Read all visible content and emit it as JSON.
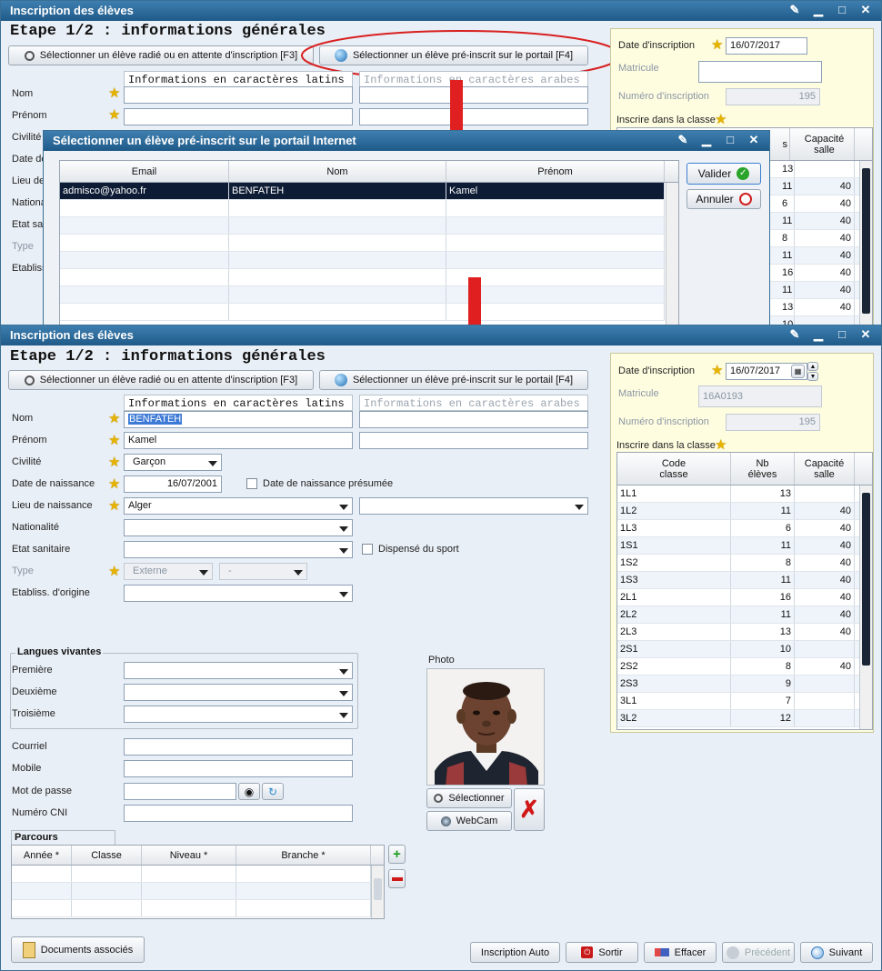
{
  "window_title": "Inscription des élèves",
  "step_title": "Etape 1/2 : informations générales",
  "buttons": {
    "select_radie": "Sélectionner un élève radié ou en attente d'inscription [F3]",
    "select_preinscrit": "Sélectionner un élève pré-inscrit sur le portail [F4]"
  },
  "headers": {
    "latin": "Informations en caractères latins",
    "arabic": "Informations en caractères arabes"
  },
  "labels": {
    "nom": "Nom",
    "prenom": "Prénom",
    "civilite": "Civilité",
    "date_naissance": "Date de naissance",
    "lieu_naissance": "Lieu de naissance",
    "nationalite": "Nationalité",
    "etat_sanitaire": "Etat sanitaire",
    "type": "Type",
    "etabliss": "Etabliss. d'origine",
    "date_presumee": "Date de naissance présumée",
    "dispense": "Dispensé du sport",
    "langues": "Langues vivantes",
    "premiere": "Première",
    "deuxieme": "Deuxième",
    "troisieme": "Troisième",
    "courriel": "Courriel",
    "mobile": "Mobile",
    "mot_de_passe": "Mot de passe",
    "cni": "Numéro CNI",
    "parcours": "Parcours",
    "photo": "Photo",
    "date_inscription": "Date d'inscription",
    "matricule": "Matricule",
    "numero_inscription": "Numéro d'inscription",
    "inscrire_classe": "Inscrire dans la classe"
  },
  "top_window": {
    "date_inscription": "16/07/2017",
    "numero": "195",
    "truncated_labels": [
      "Civilité",
      "Date de",
      "Lieu de",
      "Nationa",
      "Etat sa",
      "Type",
      "Etabliss"
    ],
    "class_col_partial": "s",
    "class_col_capacite": "Capacité\nsalle",
    "rows": [
      {
        "nb": "13",
        "cap": ""
      },
      {
        "nb": "11",
        "cap": "40"
      },
      {
        "nb": "6",
        "cap": "40"
      },
      {
        "nb": "11",
        "cap": "40"
      },
      {
        "nb": "8",
        "cap": "40"
      },
      {
        "nb": "11",
        "cap": "40"
      },
      {
        "nb": "16",
        "cap": "40"
      },
      {
        "nb": "11",
        "cap": "40"
      },
      {
        "nb": "13",
        "cap": "40"
      },
      {
        "nb": "10",
        "cap": ""
      }
    ]
  },
  "dialog": {
    "title": "Sélectionner un élève pré-inscrit sur le portail Internet",
    "columns": [
      "Email",
      "Nom",
      "Prénom"
    ],
    "row": {
      "email": "admisco@yahoo.fr",
      "nom": "BENFATEH",
      "prenom": "Kamel"
    },
    "valider": "Valider",
    "annuler": "Annuler"
  },
  "form": {
    "nom": "BENFATEH",
    "prenom": "Kamel",
    "civilite": "Garçon",
    "date_naissance": "16/07/2001",
    "lieu_naissance": "Alger",
    "type": "Externe",
    "type2": "-",
    "date_inscription": "16/07/2017",
    "matricule": "16A0193",
    "numero_inscription": "195"
  },
  "classes": {
    "columns": [
      "Code\nclasse",
      "Nb\nélèves",
      "Capacité\nsalle"
    ],
    "rows": [
      {
        "code": "1L1",
        "nb": "13",
        "cap": ""
      },
      {
        "code": "1L2",
        "nb": "11",
        "cap": "40"
      },
      {
        "code": "1L3",
        "nb": "6",
        "cap": "40"
      },
      {
        "code": "1S1",
        "nb": "11",
        "cap": "40"
      },
      {
        "code": "1S2",
        "nb": "8",
        "cap": "40"
      },
      {
        "code": "1S3",
        "nb": "11",
        "cap": "40"
      },
      {
        "code": "2L1",
        "nb": "16",
        "cap": "40"
      },
      {
        "code": "2L2",
        "nb": "11",
        "cap": "40"
      },
      {
        "code": "2L3",
        "nb": "13",
        "cap": "40"
      },
      {
        "code": "2S1",
        "nb": "10",
        "cap": ""
      },
      {
        "code": "2S2",
        "nb": "8",
        "cap": "40"
      },
      {
        "code": "2S3",
        "nb": "9",
        "cap": ""
      },
      {
        "code": "3L1",
        "nb": "7",
        "cap": ""
      },
      {
        "code": "3L2",
        "nb": "12",
        "cap": ""
      }
    ]
  },
  "parcours": {
    "columns": [
      "Année *",
      "Classe",
      "Niveau *",
      "Branche *"
    ]
  },
  "photo_buttons": {
    "selectionner": "Sélectionner",
    "webcam": "WebCam"
  },
  "footer": {
    "documents": "Documents associés",
    "inscription_auto": "Inscription Auto",
    "sortir": "Sortir",
    "effacer": "Effacer",
    "precedent": "Précédent",
    "suivant": "Suivant"
  }
}
